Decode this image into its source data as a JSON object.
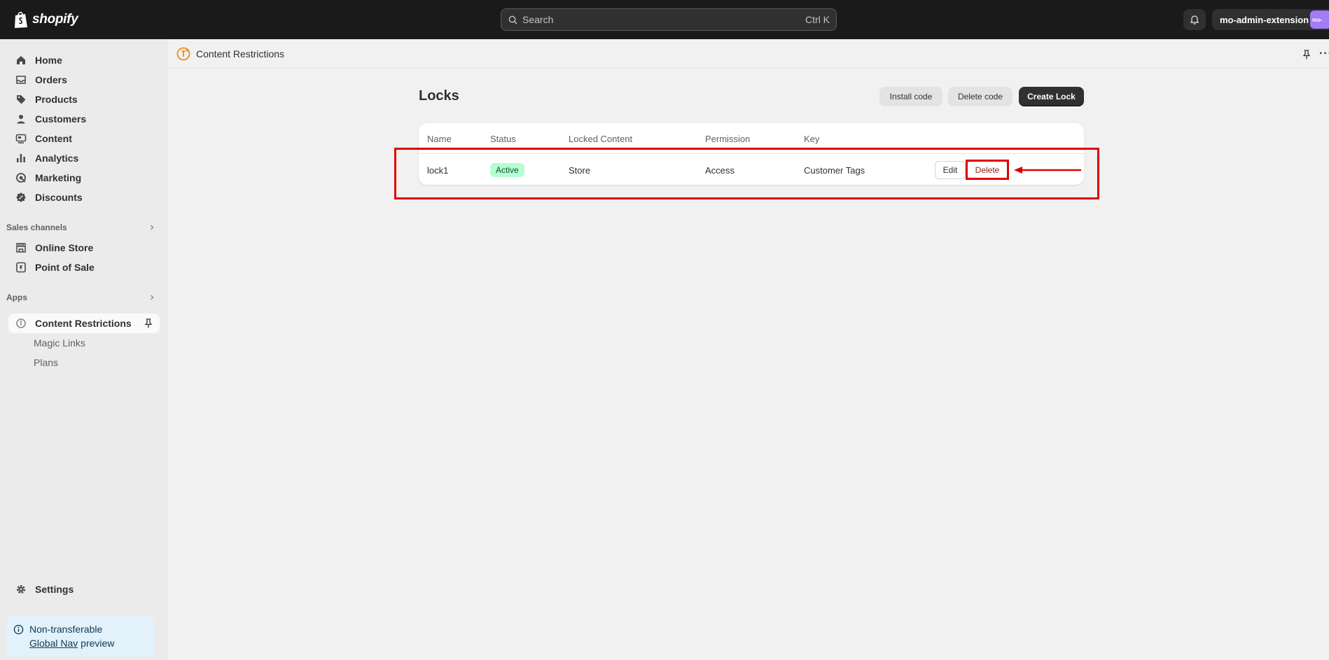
{
  "topbar": {
    "logo_text": "shopify",
    "search_placeholder": "Search",
    "search_shortcut": "Ctrl K",
    "store_name": "mo-admin-extension",
    "avatar_text": "mo-"
  },
  "sidebar": {
    "items": [
      {
        "label": "Home",
        "icon": "home-icon"
      },
      {
        "label": "Orders",
        "icon": "orders-icon"
      },
      {
        "label": "Products",
        "icon": "tag-icon"
      },
      {
        "label": "Customers",
        "icon": "person-icon"
      },
      {
        "label": "Content",
        "icon": "content-icon"
      },
      {
        "label": "Analytics",
        "icon": "bar-chart-icon"
      },
      {
        "label": "Marketing",
        "icon": "target-icon"
      },
      {
        "label": "Discounts",
        "icon": "discount-icon"
      }
    ],
    "sales_channels_label": "Sales channels",
    "channels": [
      {
        "label": "Online Store",
        "icon": "storefront-icon"
      },
      {
        "label": "Point of Sale",
        "icon": "pos-icon"
      }
    ],
    "apps_label": "Apps",
    "app_active": "Content Restrictions",
    "app_subitems": [
      "Magic Links",
      "Plans"
    ],
    "settings_label": "Settings",
    "notice_line1": "Non-transferable",
    "notice_link": "Global Nav",
    "notice_line2_rest": " preview"
  },
  "app_header": {
    "title": "Content Restrictions"
  },
  "page": {
    "title": "Locks",
    "buttons": {
      "install": "Install code",
      "delete_code": "Delete code",
      "create": "Create Lock"
    },
    "table": {
      "headers": [
        "Name",
        "Status",
        "Locked Content",
        "Permission",
        "Key"
      ],
      "rows": [
        {
          "name": "lock1",
          "status": "Active",
          "locked_content": "Store",
          "permission": "Access",
          "key": "Customer Tags",
          "edit_label": "Edit",
          "delete_label": "Delete"
        }
      ]
    }
  },
  "colors": {
    "topbar": "#1a1a1a",
    "annotation": "#e00000",
    "badge_bg": "#b4fed2",
    "avatar": "#a27cf7"
  }
}
